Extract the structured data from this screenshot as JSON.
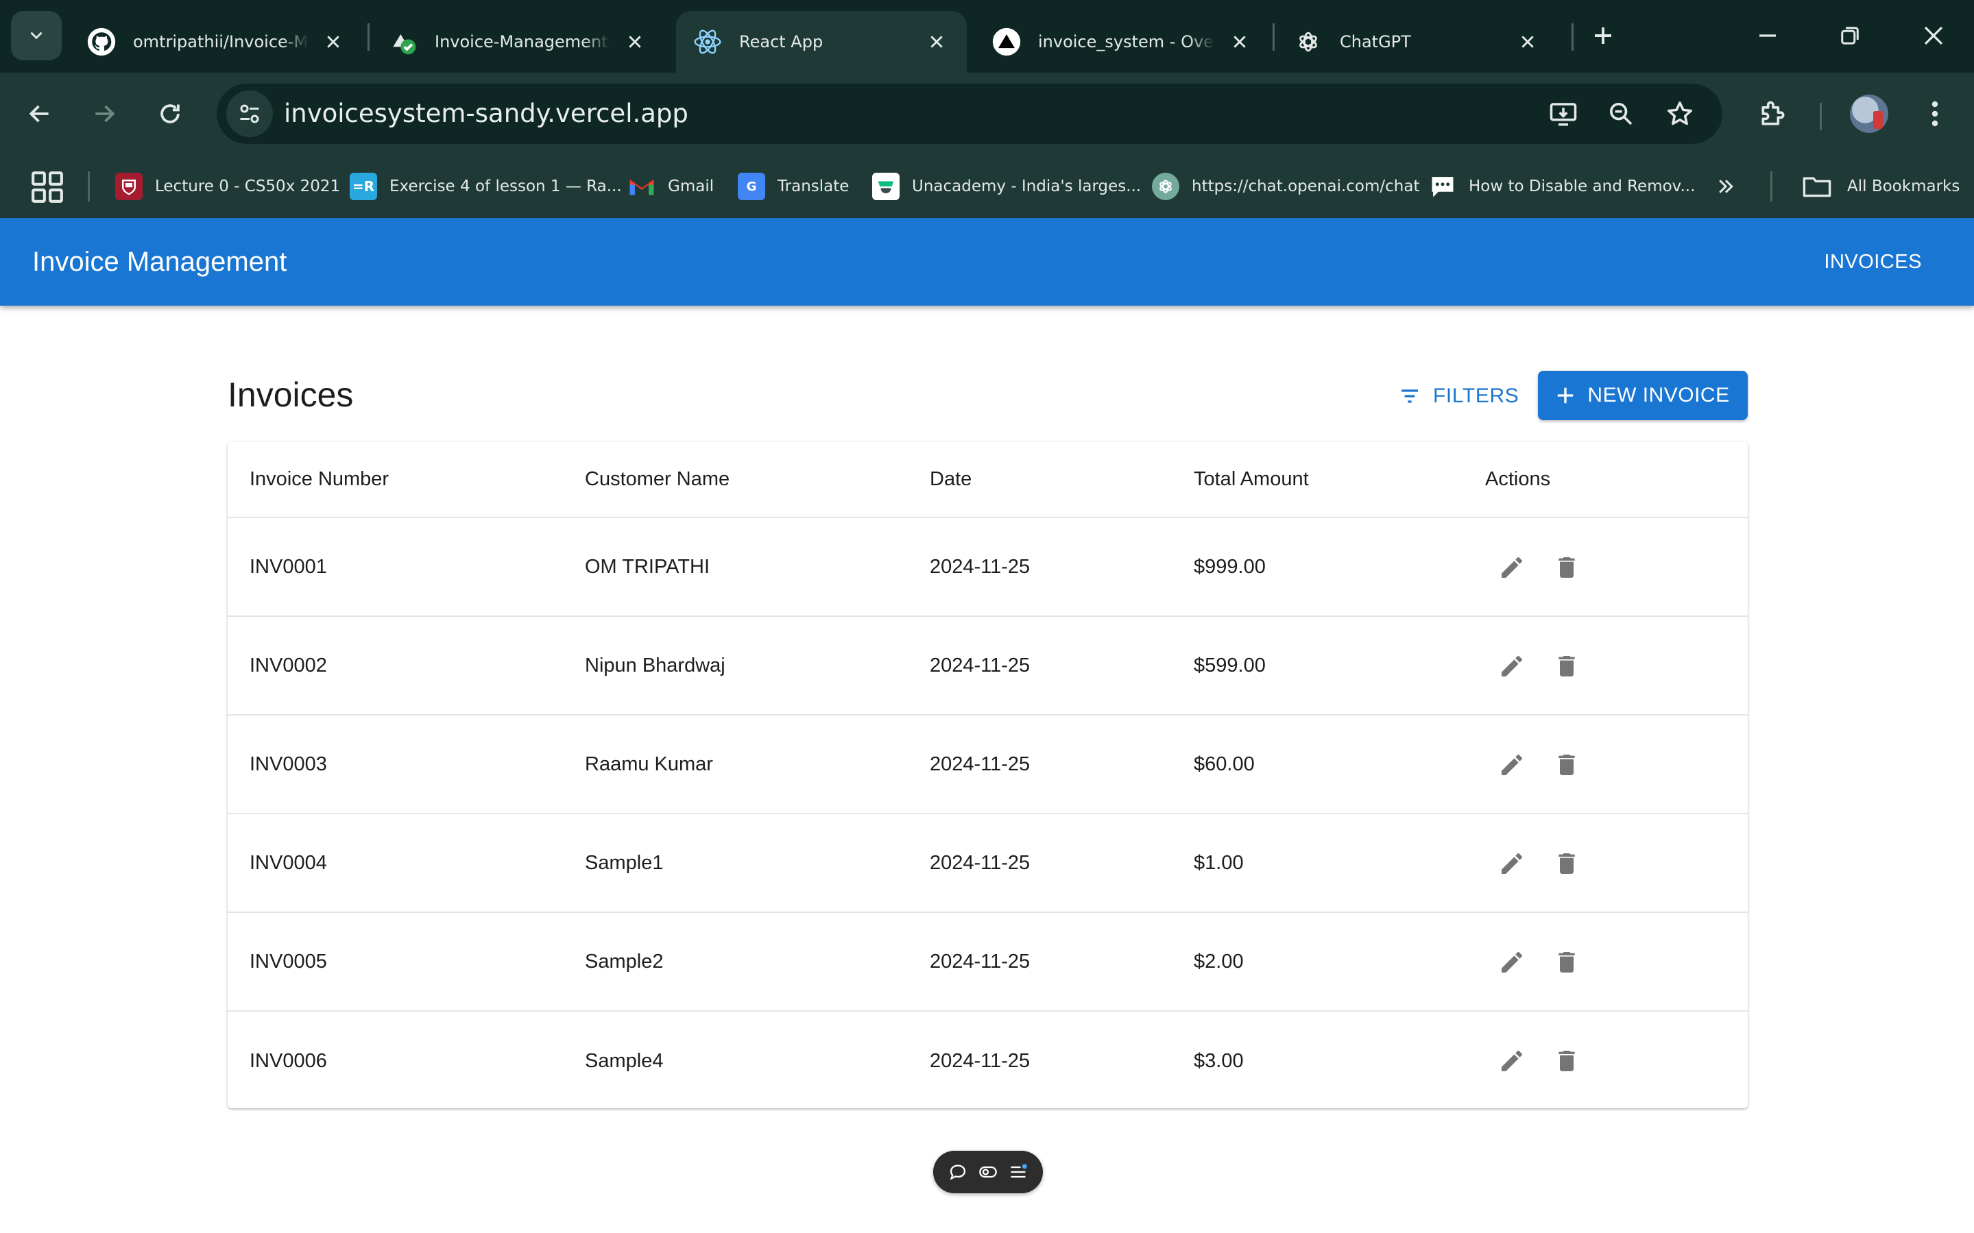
{
  "browser": {
    "tabs": [
      {
        "title": "omtripathii/Invoice-Man",
        "icon": "github-icon"
      },
      {
        "title": "Invoice-Management-Sy",
        "icon": "deploy-check-icon"
      },
      {
        "title": "React App",
        "icon": "react-icon",
        "active": true
      },
      {
        "title": "invoice_system - Overvi",
        "icon": "vercel-icon"
      },
      {
        "title": "ChatGPT",
        "icon": "openai-icon"
      }
    ],
    "url": "invoicesystem-sandy.vercel.app",
    "bookmarks": [
      {
        "label": "Lecture 0 - CS50x 2021",
        "icon": "harvard-icon",
        "color": "#a51c30"
      },
      {
        "label": "Exercise 4 of lesson 1 — Ra...",
        "icon": "edu-icon",
        "color": "#29a8e0"
      },
      {
        "label": "Gmail",
        "icon": "gmail-icon",
        "color": "#ea4335"
      },
      {
        "label": "Translate",
        "icon": "translate-icon",
        "color": "#4285f4"
      },
      {
        "label": "Unacademy - India's larges...",
        "icon": "unacademy-icon",
        "color": "#08bd80"
      },
      {
        "label": "https://chat.openai.com/chat",
        "icon": "openai-icon",
        "color": "#74aa9c"
      },
      {
        "label": "How to Disable and Remov...",
        "icon": "chat-bubble-icon",
        "color": "#ffffff"
      }
    ],
    "all_bookmarks": "All Bookmarks"
  },
  "app": {
    "title": "Invoice Management",
    "nav_invoices": "INVOICES",
    "page_title": "Invoices",
    "filters_label": "FILTERS",
    "new_invoice_label": "NEW INVOICE",
    "brand_color": "#1976d2"
  },
  "table": {
    "headers": [
      "Invoice Number",
      "Customer Name",
      "Date",
      "Total Amount",
      "Actions"
    ],
    "rows": [
      [
        "INV0001",
        "OM TRIPATHI",
        "2024-11-25",
        "$999.00"
      ],
      [
        "INV0002",
        "Nipun Bhardwaj",
        "2024-11-25",
        "$599.00"
      ],
      [
        "INV0003",
        "Raamu Kumar",
        "2024-11-25",
        "$60.00"
      ],
      [
        "INV0004",
        "Sample1",
        "2024-11-25",
        "$1.00"
      ],
      [
        "INV0005",
        "Sample2",
        "2024-11-25",
        "$2.00"
      ],
      [
        "INV0006",
        "Sample4",
        "2024-11-25",
        "$3.00"
      ]
    ]
  }
}
